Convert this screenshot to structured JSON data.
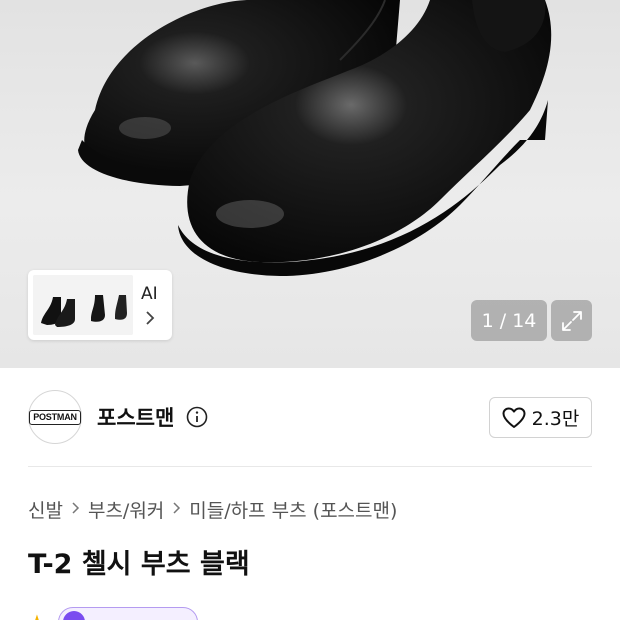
{
  "gallery": {
    "counter": "1 / 14",
    "thumbnail_ai_label": "AI",
    "thumbnail_chevron": "chevron-right-icon",
    "expand_icon": "expand-icon"
  },
  "brand": {
    "logo_text": "POSTMAN",
    "name": "포스트맨",
    "info_icon": "info-icon"
  },
  "like": {
    "icon": "heart-icon",
    "count": "2.3만"
  },
  "breadcrumb": [
    "신발",
    "부츠/워커",
    "미들/하프 부츠 (포스트맨)"
  ],
  "product": {
    "title": "T-2 첼시 부츠 블랙"
  },
  "rating": {
    "star_icon": "star-icon",
    "accent_color": "#7a4cf0"
  },
  "colors": {
    "hero_bg": "#e6e6e6",
    "overlay_button": "rgba(110,110,110,0.45)",
    "pill_border": "#b49bf0"
  }
}
